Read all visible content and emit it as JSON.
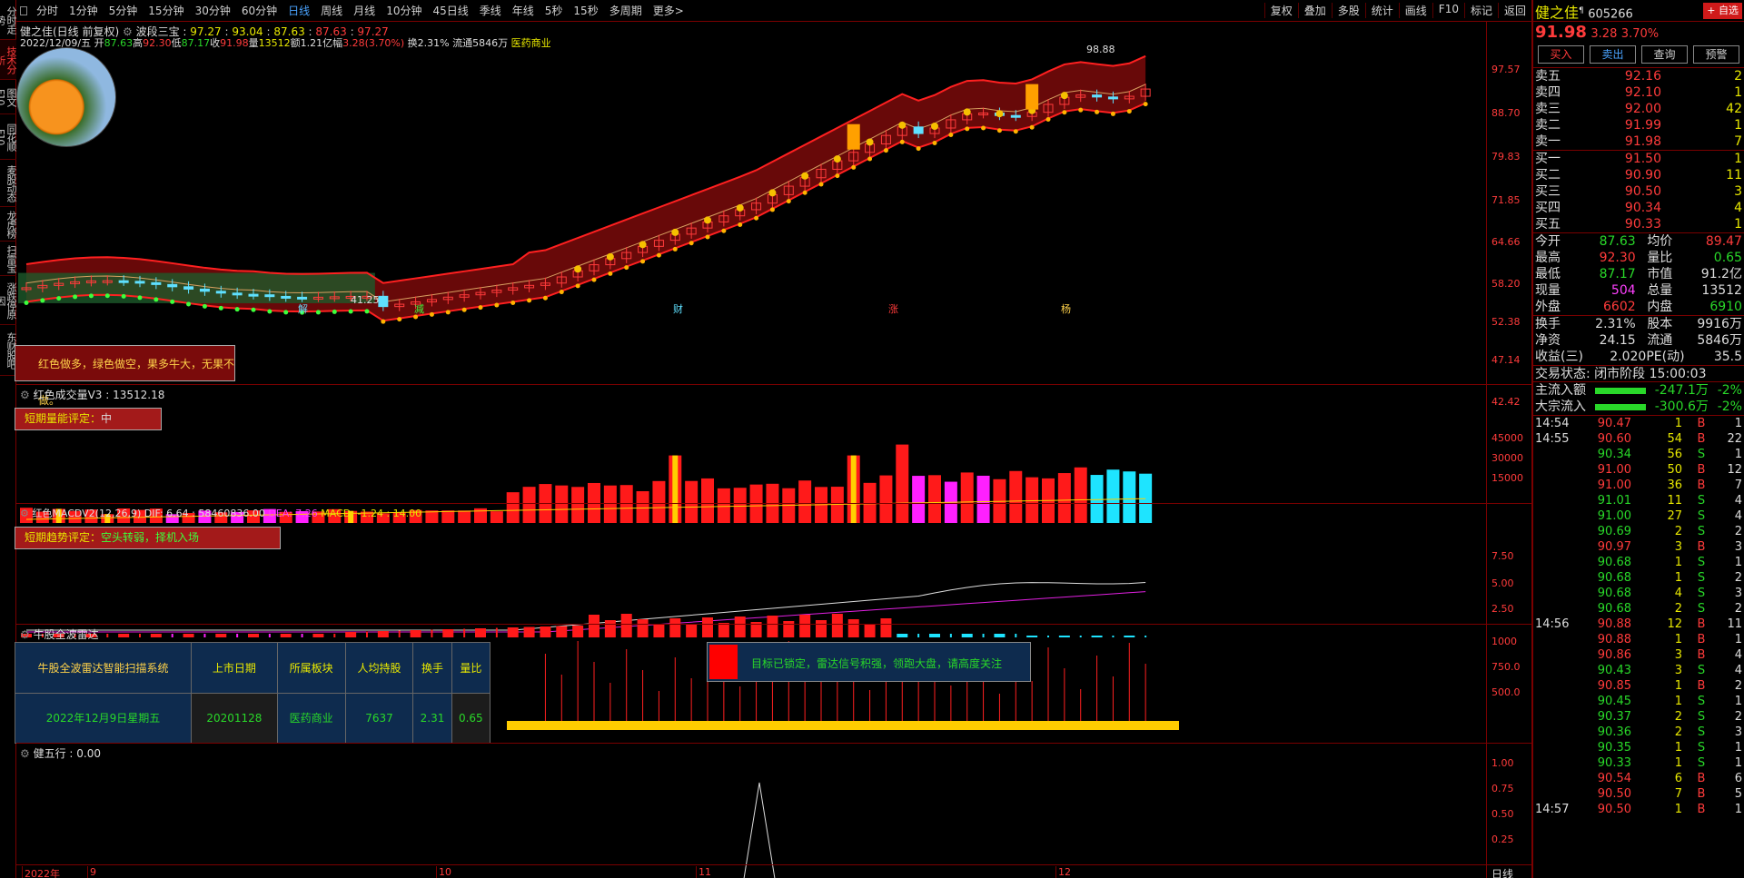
{
  "left_tabs": [
    "分时走势",
    "技术分析",
    "图文F10",
    "同花顺F10",
    "麦股动态",
    "龙虎榜",
    "扫雷宝",
    "涨跌停原因",
    "东财股吧"
  ],
  "periods": [
    "分时",
    "1分钟",
    "5分钟",
    "15分钟",
    "30分钟",
    "60分钟",
    "日线",
    "周线",
    "月线",
    "10分钟",
    "45日线",
    "季线",
    "年线",
    "5秒",
    "15秒",
    "多周期",
    "更多>"
  ],
  "active_period": "日线",
  "right_tools": [
    "复权",
    "叠加",
    "多股",
    "统计",
    "画线",
    "F10",
    "标记",
    "返回"
  ],
  "main_title": {
    "name": "健之佳(日线 前复权)",
    "indicator": "波段三宝 : ",
    "v1": "97.27",
    "v2": "93.04",
    "v3": "87.63",
    "v4": "87.63",
    "v5": "97.27"
  },
  "info_line": {
    "date": "2022/12/09/五",
    "open_label": "开",
    "open": "87.63",
    "high_label": "高",
    "high": "92.30",
    "low_label": "低",
    "low": "87.17",
    "close_label": "收",
    "close": "91.98",
    "vol_label": "量",
    "vol": "13512",
    "amt_label": "额",
    "amt": "1.21亿",
    "chg_label": "幅",
    "chg": "3.28(3.70%)",
    "turn_label": "换",
    "turn": "2.31%",
    "float_label": "流通",
    "float": "5846万",
    "sector": "医药商业"
  },
  "main_y": [
    "97.57",
    "88.70",
    "79.83",
    "71.85",
    "64.66",
    "58.20",
    "52.38",
    "47.14",
    "42.42"
  ],
  "hi_label": "98.88",
  "lo_label": "41.25",
  "signal_labels": [
    "解",
    "减",
    "财",
    "涨",
    "杨"
  ],
  "red_note": "红色做多，绿色做空，果多牛大，无果不做。",
  "vol_title": {
    "name": "红色成交量V3 : ",
    "value": "13512.18"
  },
  "vol_box": {
    "label": "短期量能评定：",
    "value": "中"
  },
  "vol_y": [
    "45000",
    "30000",
    "15000"
  ],
  "macd_title": {
    "name": "红色MACDV2(12,26,9)",
    "dif_label": "DIF: ",
    "dif": "6.64",
    "x": " : 58460836.00",
    "dea_label": "DEA: ",
    "dea": "7.26",
    "macd_label": "MACD: ",
    "macd": "-1.24 : 14.00"
  },
  "macd_box": {
    "label": "短期趋势评定：",
    "value": "空头转弱，择机入场"
  },
  "macd_y": [
    "7.50",
    "5.00",
    "2.50"
  ],
  "radar_title": "牛股全波雷达",
  "radar_table": {
    "system": "牛股全波雷达智能扫描系统",
    "date": "2022年12月9日星期五",
    "headers": [
      "上市日期",
      "所属板块",
      "人均持股",
      "换手",
      "量比"
    ],
    "values": [
      "20201128",
      "医药商业",
      "7637",
      "2.31",
      "0.65"
    ]
  },
  "radar_msg": "目标已锁定，雷达信号积强，领跑大盘，请高度关注",
  "radar_y": [
    "1000",
    "750.0",
    "500.0"
  ],
  "wx_title": {
    "name": "健五行 : ",
    "value": "0.00"
  },
  "wx_y": [
    "1.00",
    "0.75",
    "0.50",
    "0.25"
  ],
  "x_axis": [
    "2022年",
    "9",
    "10",
    "11",
    "12"
  ],
  "x_period": "日线",
  "stock": {
    "name": "健之佳",
    "sup": "¶",
    "code": "605266",
    "add_btn": "+ 自选",
    "price": "91.98",
    "chg": "3.28",
    "pct": "3.70%"
  },
  "trade_btns": [
    "买入",
    "卖出",
    "查询",
    "预警"
  ],
  "asks": [
    [
      "卖五",
      "92.16",
      "2"
    ],
    [
      "卖四",
      "92.10",
      "1"
    ],
    [
      "卖三",
      "92.00",
      "42"
    ],
    [
      "卖二",
      "91.99",
      "1"
    ],
    [
      "卖一",
      "91.98",
      "7"
    ]
  ],
  "bids": [
    [
      "买一",
      "91.50",
      "1"
    ],
    [
      "买二",
      "90.90",
      "11"
    ],
    [
      "买三",
      "90.50",
      "3"
    ],
    [
      "买四",
      "90.34",
      "4"
    ],
    [
      "买五",
      "90.33",
      "1"
    ]
  ],
  "stats": [
    [
      "今开",
      "87.63",
      "均价",
      "89.47"
    ],
    [
      "最高",
      "92.30",
      "量比",
      "0.65"
    ],
    [
      "最低",
      "87.17",
      "市值",
      "91.2亿"
    ],
    [
      "现量",
      "504",
      "总量",
      "13512"
    ],
    [
      "外盘",
      "6602",
      "内盘",
      "6910"
    ]
  ],
  "stats2": [
    [
      "换手",
      "2.31%",
      "股本",
      "9916万"
    ],
    [
      "净资",
      "24.15",
      "流通",
      "5846万"
    ],
    [
      "收益(三)",
      "2.020",
      "PE(动)",
      "35.5"
    ]
  ],
  "trade_state": {
    "label": "交易状态:",
    "value": "闭市阶段 15:00:03"
  },
  "flows": [
    {
      "label": "主流入额",
      "value": "-247.1万",
      "pct": "-2%"
    },
    {
      "label": "大宗流入",
      "value": "-300.6万",
      "pct": "-2%"
    }
  ],
  "ticks": [
    [
      "14:54",
      "90.47",
      "1",
      "B",
      "1"
    ],
    [
      "14:55",
      "90.60",
      "54",
      "B",
      "22"
    ],
    [
      "",
      "90.34",
      "56",
      "S",
      "1"
    ],
    [
      "",
      "91.00",
      "50",
      "B",
      "12"
    ],
    [
      "",
      "91.00",
      "36",
      "B",
      "7"
    ],
    [
      "",
      "91.01",
      "11",
      "S",
      "4"
    ],
    [
      "",
      "91.00",
      "27",
      "S",
      "4"
    ],
    [
      "",
      "90.69",
      "2",
      "S",
      "2"
    ],
    [
      "",
      "90.97",
      "3",
      "B",
      "3"
    ],
    [
      "",
      "90.68",
      "1",
      "S",
      "1"
    ],
    [
      "",
      "90.68",
      "1",
      "S",
      "2"
    ],
    [
      "",
      "90.68",
      "4",
      "S",
      "3"
    ],
    [
      "",
      "90.68",
      "2",
      "S",
      "2"
    ],
    [
      "14:56",
      "90.88",
      "12",
      "B",
      "11"
    ],
    [
      "",
      "90.88",
      "1",
      "B",
      "1"
    ],
    [
      "",
      "90.86",
      "3",
      "B",
      "4"
    ],
    [
      "",
      "90.43",
      "3",
      "S",
      "4"
    ],
    [
      "",
      "90.85",
      "1",
      "B",
      "2"
    ],
    [
      "",
      "90.45",
      "1",
      "S",
      "1"
    ],
    [
      "",
      "90.37",
      "2",
      "S",
      "2"
    ],
    [
      "",
      "90.36",
      "2",
      "S",
      "3"
    ],
    [
      "",
      "90.35",
      "1",
      "S",
      "1"
    ],
    [
      "",
      "90.33",
      "1",
      "S",
      "1"
    ],
    [
      "",
      "90.54",
      "6",
      "B",
      "6"
    ],
    [
      "",
      "90.50",
      "7",
      "B",
      "5"
    ],
    [
      "14:57",
      "90.50",
      "1",
      "B",
      "1"
    ]
  ],
  "colors": {
    "up": "#ff3b3b",
    "down": "#29d829",
    "frame": "#7a0000",
    "cyan": "#5fe0ff"
  }
}
